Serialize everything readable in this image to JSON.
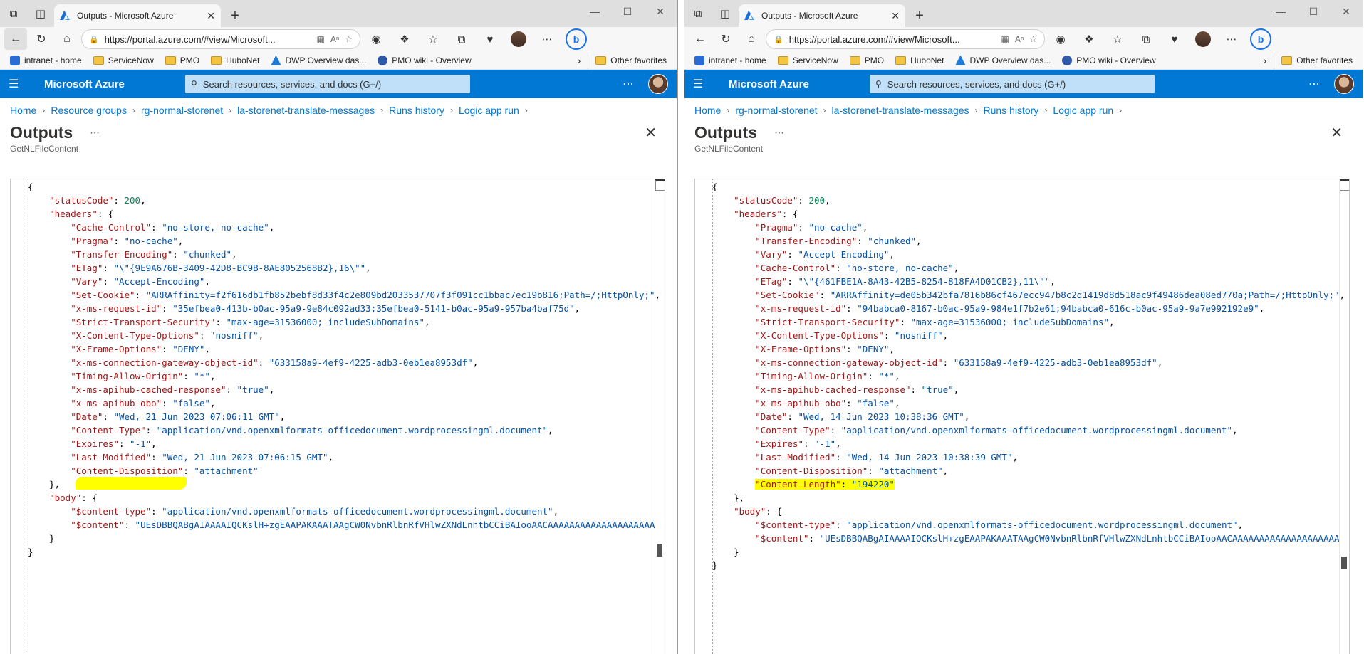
{
  "windows": [
    {
      "id": "left",
      "tab_title": "Outputs - Microsoft Azure",
      "url": "https://portal.azure.com/#view/Microsoft...",
      "favorites": [
        "intranet - home",
        "ServiceNow",
        "PMO",
        "HuboNet",
        "DWP Overview das...",
        "PMO wiki - Overview"
      ],
      "other_favorites": "Other favorites",
      "brand": "Microsoft Azure",
      "search_placeholder": "Search resources, services, and docs (G+/)",
      "breadcrumb": [
        "Home",
        "Resource groups",
        "rg-normal-storenet",
        "la-storenet-translate-messages",
        "Runs history",
        "Logic app run"
      ],
      "title": "Outputs",
      "subtitle": "GetNLFileContent",
      "status_code": "200",
      "headers": [
        [
          "Cache-Control",
          "no-store, no-cache"
        ],
        [
          "Pragma",
          "no-cache"
        ],
        [
          "Transfer-Encoding",
          "chunked"
        ],
        [
          "ETag",
          "\\\"{9E9A676B-3409-42D8-BC9B-8AE8052568B2},16\\\""
        ],
        [
          "Vary",
          "Accept-Encoding"
        ],
        [
          "Set-Cookie",
          "ARRAffinity=f2f616db1fb852bebf8d33f4c2e809bd2033537707f3f091cc1bbac7ec19b816;Path=/;HttpOnly;"
        ],
        [
          "x-ms-request-id",
          "35efbea0-413b-b0ac-95a9-9e84c092ad33;35efbea0-5141-b0ac-95a9-957ba4baf75d"
        ],
        [
          "Strict-Transport-Security",
          "max-age=31536000; includeSubDomains"
        ],
        [
          "X-Content-Type-Options",
          "nosniff"
        ],
        [
          "X-Frame-Options",
          "DENY"
        ],
        [
          "x-ms-connection-gateway-object-id",
          "633158a9-4ef9-4225-adb3-0eb1ea8953df"
        ],
        [
          "Timing-Allow-Origin",
          "*"
        ],
        [
          "x-ms-apihub-cached-response",
          "true"
        ],
        [
          "x-ms-apihub-obo",
          "false"
        ],
        [
          "Date",
          "Wed, 21 Jun 2023 07:06:11 GMT"
        ],
        [
          "Content-Type",
          "application/vnd.openxmlformats-officedocument.wordprocessingml.document"
        ],
        [
          "Expires",
          "-1"
        ],
        [
          "Last-Modified",
          "Wed, 21 Jun 2023 07:06:15 GMT"
        ],
        [
          "Content-Disposition",
          "attachment"
        ]
      ],
      "highlight_header": "",
      "body_content_type": "application/vnd.openxmlformats-officedocument.wordprocessingml.document",
      "body_content": "UEsDBBQABgAIAAAAIQCKslH+zgEAAPAKAAATAAgCW0NvbnRlbnRfVHlwZXNdLnhtbCCiBAIooAACAAAAAAAAAAAAAAAAAAAA"
    },
    {
      "id": "right",
      "tab_title": "Outputs - Microsoft Azure",
      "url": "https://portal.azure.com/#view/Microsoft...",
      "favorites": [
        "intranet - home",
        "ServiceNow",
        "PMO",
        "HuboNet",
        "DWP Overview das...",
        "PMO wiki - Overview"
      ],
      "other_favorites": "Other favorites",
      "brand": "Microsoft Azure",
      "search_placeholder": "Search resources, services, and docs (G+/)",
      "breadcrumb": [
        "Home",
        "rg-normal-storenet",
        "la-storenet-translate-messages",
        "Runs history",
        "Logic app run"
      ],
      "title": "Outputs",
      "subtitle": "GetNLFileContent",
      "status_code": "200",
      "headers": [
        [
          "Pragma",
          "no-cache"
        ],
        [
          "Transfer-Encoding",
          "chunked"
        ],
        [
          "Vary",
          "Accept-Encoding"
        ],
        [
          "Cache-Control",
          "no-store, no-cache"
        ],
        [
          "ETag",
          "\\\"{461FBE1A-8A43-42B5-8254-818FA4D01CB2},11\\\""
        ],
        [
          "Set-Cookie",
          "ARRAffinity=de05b342bfa7816b86cf467ecc947b8c2d1419d8d518ac9f49486dea08ed770a;Path=/;HttpOnly;"
        ],
        [
          "x-ms-request-id",
          "94babca0-8167-b0ac-95a9-984e1f7b2e61;94babca0-616c-b0ac-95a9-9a7e992192e9"
        ],
        [
          "Strict-Transport-Security",
          "max-age=31536000; includeSubDomains"
        ],
        [
          "X-Content-Type-Options",
          "nosniff"
        ],
        [
          "X-Frame-Options",
          "DENY"
        ],
        [
          "x-ms-connection-gateway-object-id",
          "633158a9-4ef9-4225-adb3-0eb1ea8953df"
        ],
        [
          "Timing-Allow-Origin",
          "*"
        ],
        [
          "x-ms-apihub-cached-response",
          "true"
        ],
        [
          "x-ms-apihub-obo",
          "false"
        ],
        [
          "Date",
          "Wed, 14 Jun 2023 10:38:36 GMT"
        ],
        [
          "Content-Type",
          "application/vnd.openxmlformats-officedocument.wordprocessingml.document"
        ],
        [
          "Expires",
          "-1"
        ],
        [
          "Last-Modified",
          "Wed, 14 Jun 2023 10:38:39 GMT"
        ],
        [
          "Content-Disposition",
          "attachment"
        ],
        [
          "Content-Length",
          "194220"
        ]
      ],
      "highlight_header": "Content-Length",
      "body_content_type": "application/vnd.openxmlformats-officedocument.wordprocessingml.document",
      "body_content": "UEsDBBQABgAIAAAAIQCKslH+zgEAAPAKAAATAAgCW0NvbnRlbnRfVHlwZXNdLnhtbCCiBAIooAACAAAAAAAAAAAAAAAAAAAA"
    }
  ],
  "icons": {
    "workspaces": "workspaces-icon",
    "tab_actions": "tab-actions-icon",
    "azure_logo": "azure-logo-icon",
    "back": "back-icon",
    "refresh": "refresh-icon",
    "home": "home-icon",
    "bing": "bing-icon"
  },
  "colors": {
    "azure_blue": "#0078d4",
    "highlight": "#ffff00"
  }
}
